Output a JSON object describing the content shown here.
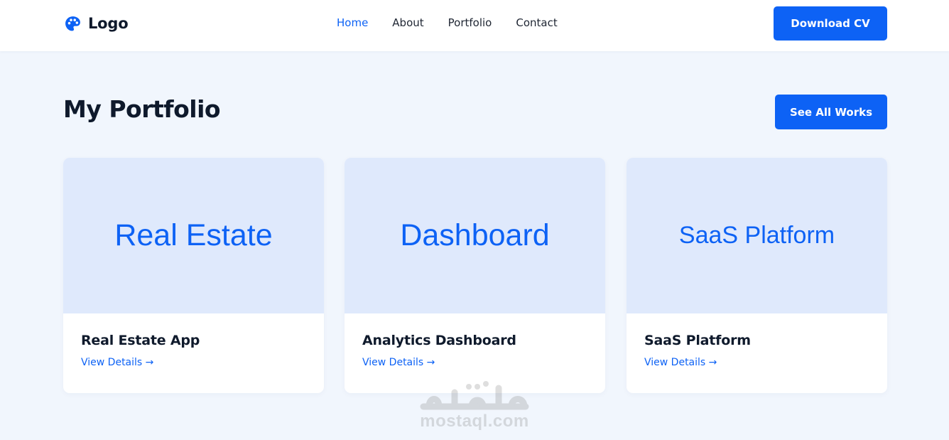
{
  "header": {
    "logo_text": "Logo",
    "logo_icon": "palette-icon",
    "nav": [
      {
        "label": "Home",
        "active": true
      },
      {
        "label": "About",
        "active": false
      },
      {
        "label": "Portfolio",
        "active": false
      },
      {
        "label": "Contact",
        "active": false
      }
    ],
    "cta_label": "Download CV"
  },
  "portfolio": {
    "title": "My Portfolio",
    "see_all_label": "See All Works",
    "cards": [
      {
        "thumb_text": "Real Estate",
        "title": "Real Estate App",
        "link": "View Details →"
      },
      {
        "thumb_text": "Dashboard",
        "title": "Analytics Dashboard",
        "link": "View Details →"
      },
      {
        "thumb_text": "SaaS Platform",
        "title": "SaaS Platform",
        "link": "View Details →"
      }
    ]
  },
  "watermark": {
    "arabic": "مستقل",
    "latin": "mostaql.com"
  },
  "colors": {
    "accent": "#0d62f5",
    "page_bg": "#f1f6fd",
    "thumb_bg": "#dfe9fc",
    "heading": "#0f1a2c"
  }
}
